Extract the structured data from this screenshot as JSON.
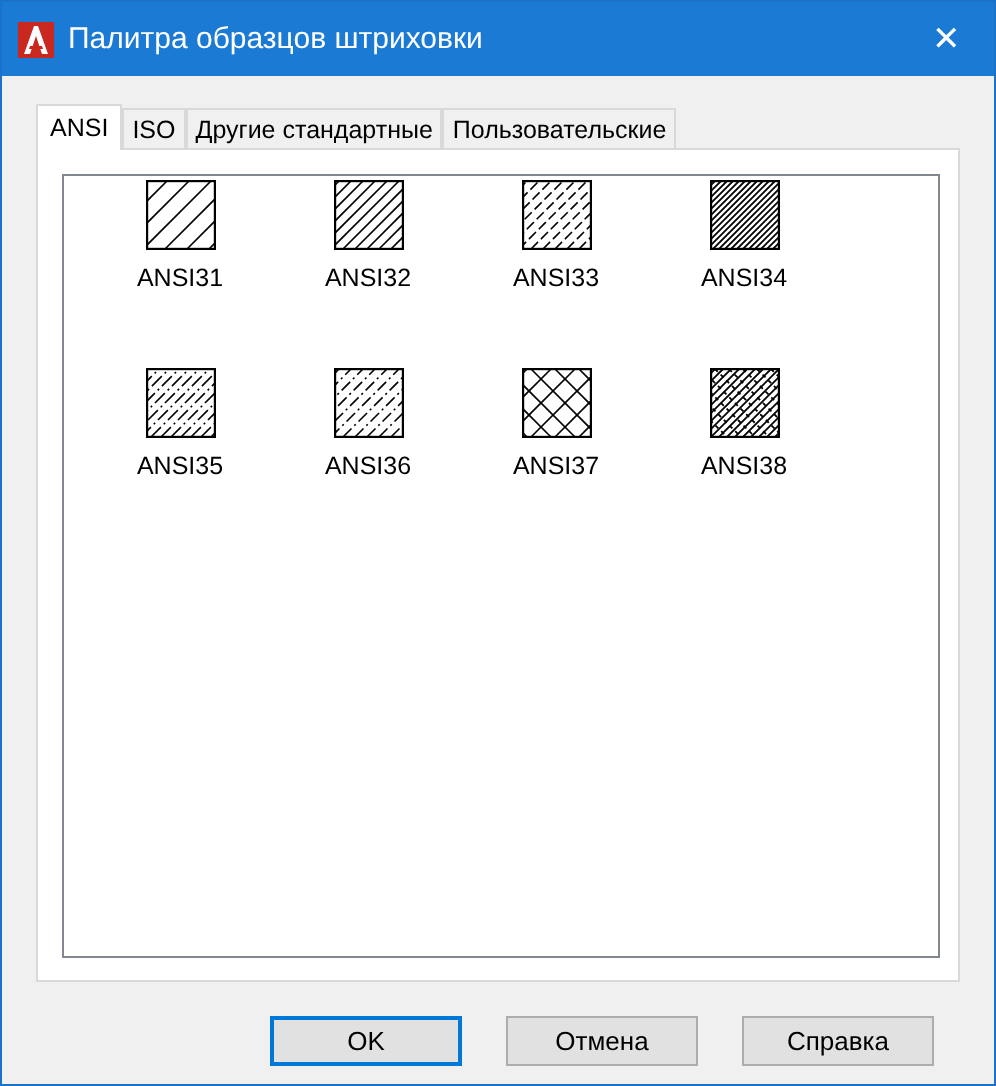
{
  "window": {
    "title": "Палитра образцов штриховки",
    "close": "✕"
  },
  "tabs": [
    {
      "label": "ANSI",
      "selected": true
    },
    {
      "label": "ISO",
      "selected": false
    },
    {
      "label": "Другие стандартные",
      "selected": false
    },
    {
      "label": "Пользовательские",
      "selected": false
    }
  ],
  "patterns": [
    {
      "name": "ANSI31",
      "kind": "single"
    },
    {
      "name": "ANSI32",
      "kind": "double"
    },
    {
      "name": "ANSI33",
      "kind": "dashed"
    },
    {
      "name": "ANSI34",
      "kind": "triple"
    },
    {
      "name": "ANSI35",
      "kind": "dashdot"
    },
    {
      "name": "ANSI36",
      "kind": "dotted"
    },
    {
      "name": "ANSI37",
      "kind": "cross"
    },
    {
      "name": "ANSI38",
      "kind": "crossdense"
    }
  ],
  "buttons": [
    {
      "label": "OK",
      "selected": true
    },
    {
      "label": "Отмена",
      "selected": false
    },
    {
      "label": "Справка",
      "selected": false
    }
  ]
}
